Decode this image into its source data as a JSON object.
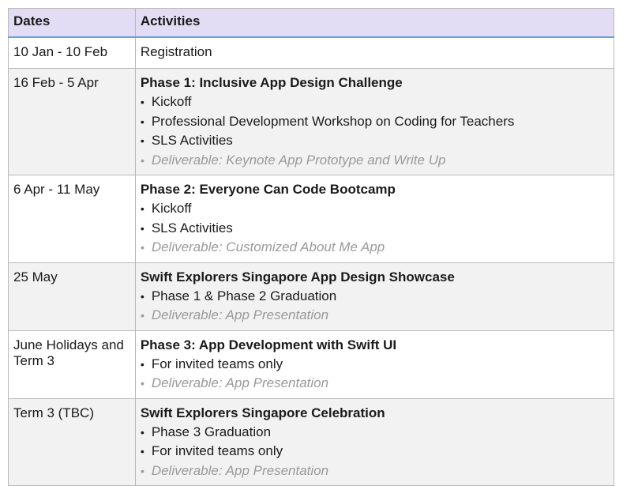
{
  "table": {
    "headers": {
      "dates": "Dates",
      "activities": "Activities"
    },
    "rows": [
      {
        "date": "10 Jan - 10 Feb",
        "activity": "Registration"
      },
      {
        "date": "16 Feb - 5 Apr",
        "title": "Phase 1: Inclusive App Design Challenge",
        "items": [
          "Kickoff",
          "Professional Development Workshop on Coding for Teachers",
          "SLS Activities"
        ],
        "deliverable": "Deliverable: Keynote App Prototype and Write Up"
      },
      {
        "date": "6 Apr - 11 May",
        "title": "Phase 2: Everyone Can Code Bootcamp",
        "items": [
          "Kickoff",
          "SLS Activities"
        ],
        "deliverable": "Deliverable: Customized About Me App"
      },
      {
        "date": "25 May",
        "title": "Swift Explorers Singapore App Design Showcase",
        "items": [
          "Phase 1 & Phase 2 Graduation"
        ],
        "deliverable": "Deliverable: App Presentation"
      },
      {
        "date": "June Holidays and Term 3",
        "title": "Phase 3: App Development with Swift UI",
        "items": [
          "For invited teams only"
        ],
        "deliverable": "Deliverable: App Presentation"
      },
      {
        "date": "Term 3 (TBC)",
        "title": "Swift Explorers Singapore Celebration",
        "items": [
          "Phase 3 Graduation",
          "For invited teams only"
        ],
        "deliverable": "Deliverable: App Presentation"
      }
    ]
  },
  "colors": {
    "header_bg": "#e3dcf5",
    "header_rule": "#6aa0d8",
    "alt_row_bg": "#f2f2f2",
    "deliverable_text": "#9a9a9a"
  }
}
